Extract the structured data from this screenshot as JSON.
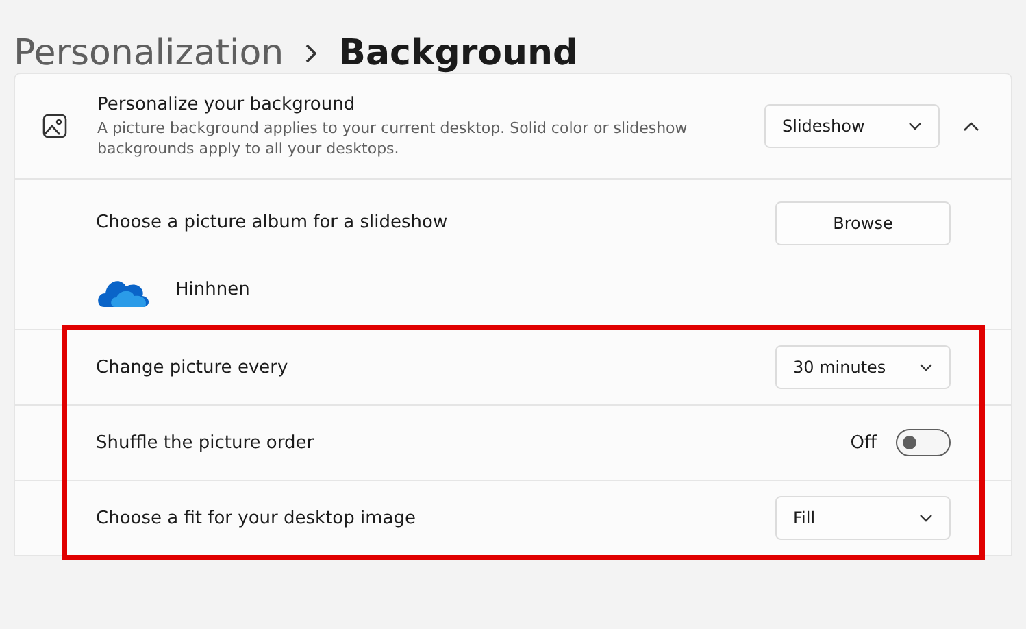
{
  "breadcrumb": {
    "parent": "Personalization",
    "current": "Background"
  },
  "header": {
    "title": "Personalize your background",
    "description": "A picture background applies to your current desktop. Solid color or slideshow backgrounds apply to all your desktops.",
    "dropdown": "Slideshow",
    "expanded": true
  },
  "album": {
    "label": "Choose a picture album for a slideshow",
    "button": "Browse",
    "folder": "Hinhnen"
  },
  "settings": [
    {
      "kind": "dropdown",
      "label": "Change picture every",
      "value": "30 minutes"
    },
    {
      "kind": "toggle",
      "label": "Shuffle the picture order",
      "state_label": "Off",
      "on": false
    },
    {
      "kind": "dropdown",
      "label": "Choose a fit for your desktop image",
      "value": "Fill"
    }
  ]
}
